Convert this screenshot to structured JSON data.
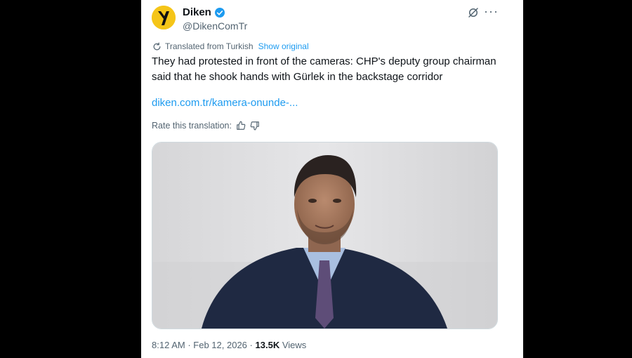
{
  "tweet": {
    "author_name": "Diken",
    "handle": "@DikenComTr",
    "translated_label": "Translated from Turkish",
    "show_original": "Show original",
    "text": "They had protested in front of the cameras: CHP's deputy group chairman said that he shook hands with Gürlek in the backstage corridor",
    "link": "diken.com.tr/kamera-onunde-...",
    "rate_label": "Rate this translation:",
    "time": "8:12 AM",
    "separator": "·",
    "date": "Feb 12, 2026",
    "separator2": "·",
    "views_count": "13.5K",
    "views_label": "Views",
    "more_label": "···"
  },
  "colors": {
    "accent": "#1d9bf0",
    "brand_yellow": "#f5c518",
    "text": "#0f1419",
    "muted": "#536471"
  },
  "icons": [
    "diken-logo-icon",
    "verified-badge-icon",
    "grok-icon",
    "more-icon",
    "translate-icon",
    "thumbs-up-icon",
    "thumbs-down-icon"
  ]
}
